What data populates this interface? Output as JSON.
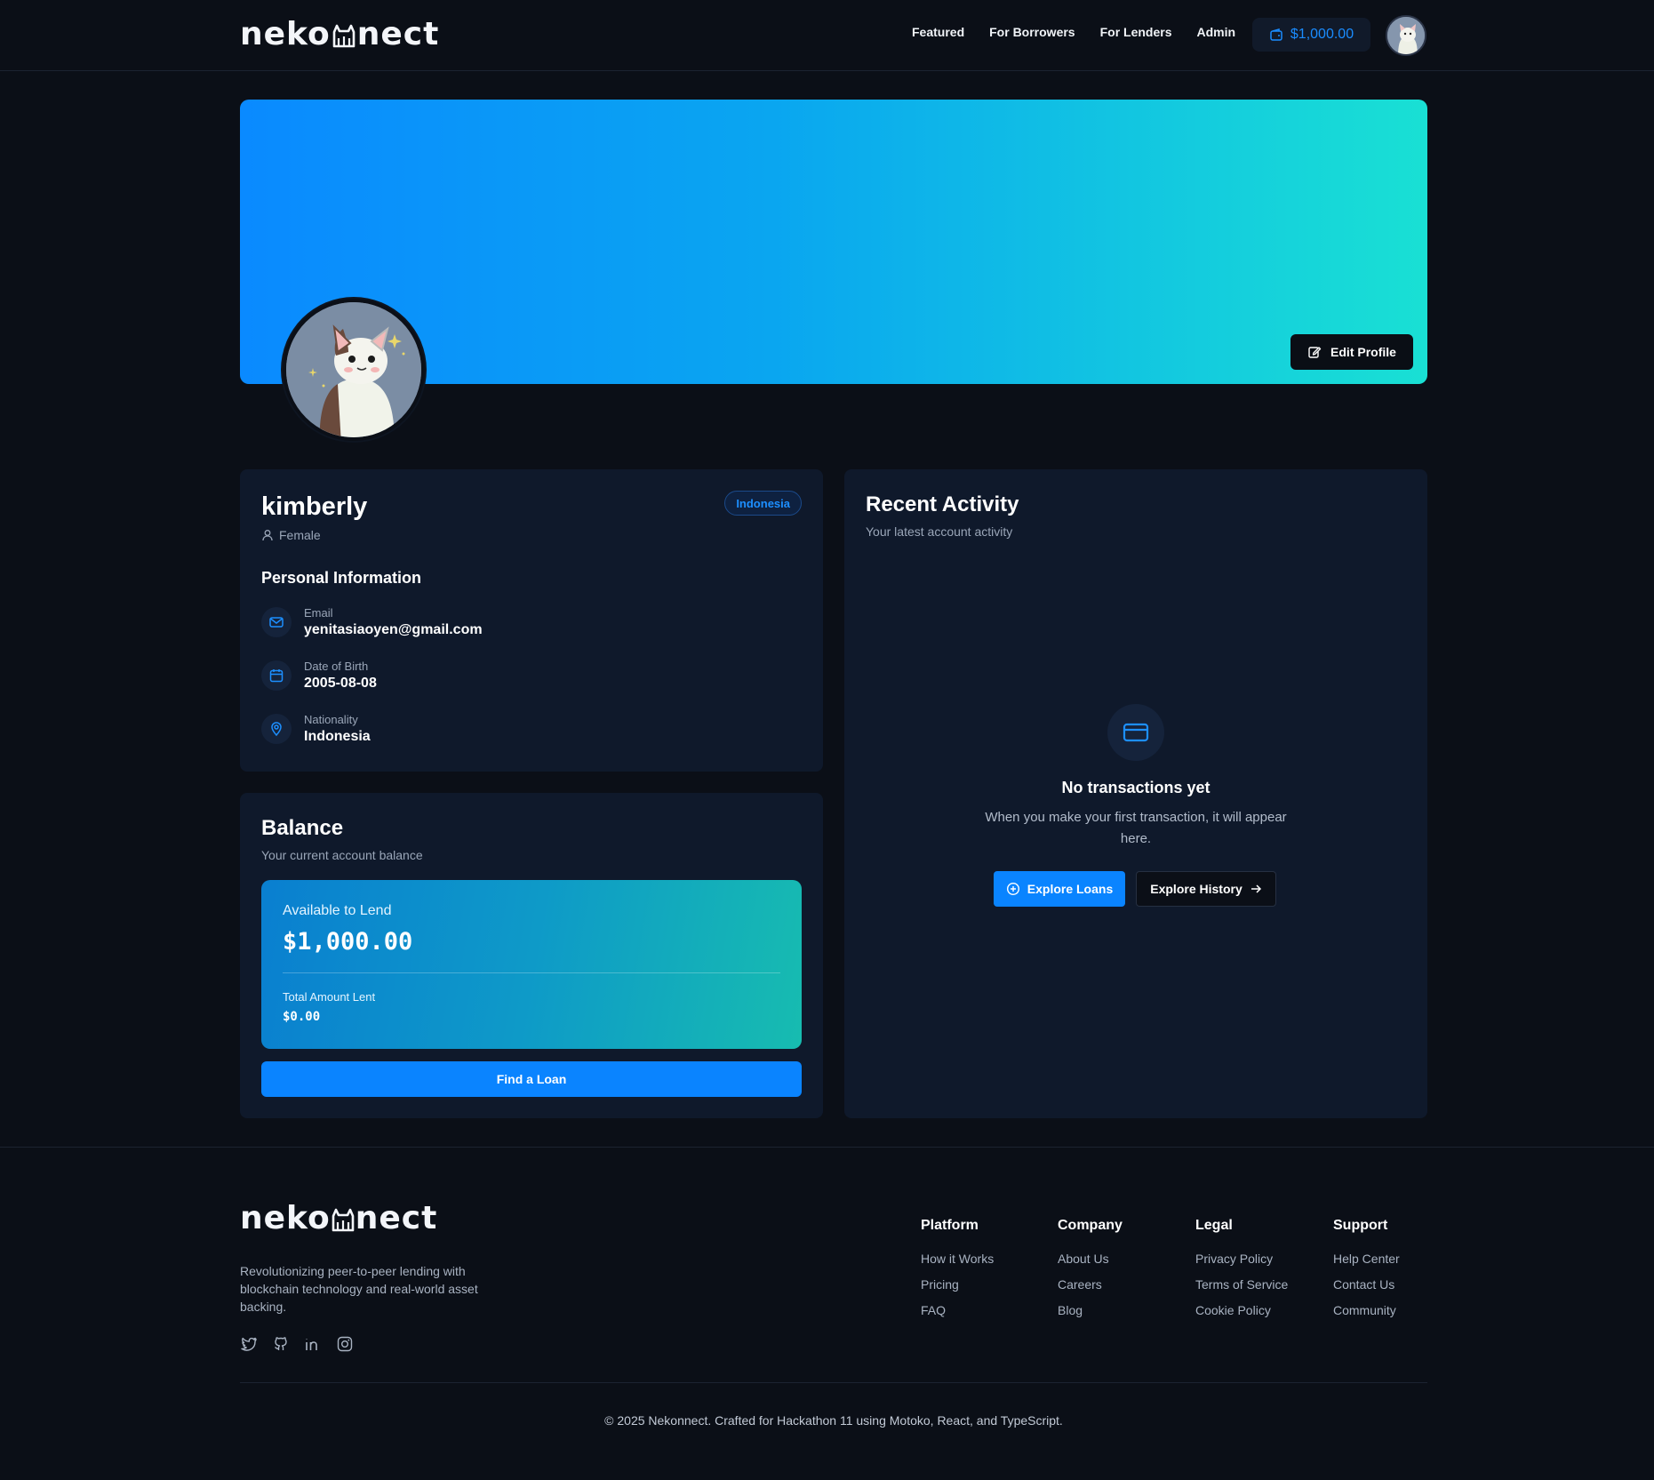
{
  "header": {
    "logo_left": "neko",
    "logo_right": "nect",
    "nav": [
      "Featured",
      "For Borrowers",
      "For Lenders",
      "Admin"
    ],
    "wallet_balance": "$1,000.00",
    "accent": "#0a84ff"
  },
  "profile": {
    "edit_label": "Edit Profile",
    "name": "kimberly",
    "gender": "Female",
    "country_badge": "Indonesia",
    "section_title": "Personal Information",
    "email_label": "Email",
    "email": "yenitasiaoyen@gmail.com",
    "dob_label": "Date of Birth",
    "dob": "2005-08-08",
    "nationality_label": "Nationality",
    "nationality": "Indonesia"
  },
  "balance": {
    "title": "Balance",
    "subtitle": "Your current account balance",
    "available_label": "Available to Lend",
    "available": "$1,000.00",
    "lent_label": "Total Amount Lent",
    "lent": "$0.00",
    "find_button": "Find a Loan"
  },
  "activity": {
    "title": "Recent Activity",
    "subtitle": "Your latest account activity",
    "empty_title": "No transactions yet",
    "empty_desc": "When you make your first transaction, it will appear here.",
    "explore_loans": "Explore Loans",
    "explore_history": "Explore History"
  },
  "footer": {
    "description": "Revolutionizing peer-to-peer lending with blockchain technology and real-world asset backing.",
    "social_icons": [
      "twitter-icon",
      "github-icon",
      "linkedin-icon",
      "instagram-icon"
    ],
    "columns": [
      {
        "title": "Platform",
        "links": [
          "How it Works",
          "Pricing",
          "FAQ"
        ]
      },
      {
        "title": "Company",
        "links": [
          "About Us",
          "Careers",
          "Blog"
        ]
      },
      {
        "title": "Legal",
        "links": [
          "Privacy Policy",
          "Terms of Service",
          "Cookie Policy"
        ]
      },
      {
        "title": "Support",
        "links": [
          "Help Center",
          "Contact Us",
          "Community"
        ]
      }
    ],
    "copyright": "© 2025 Nekonnect. Crafted for Hackathon 11 using Motoko, React, and TypeScript."
  }
}
